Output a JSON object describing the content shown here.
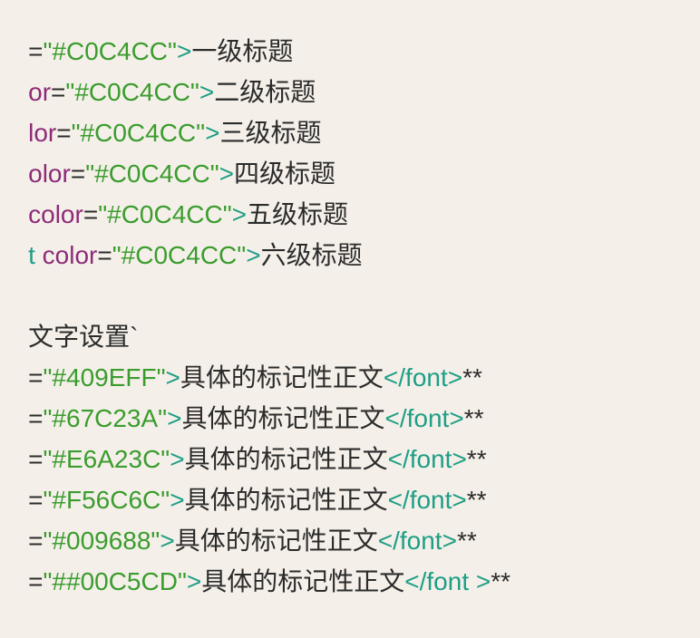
{
  "editor": {
    "heading_lines": [
      {
        "attr": "",
        "eq": "=",
        "value": "\"#C0C4CC\"",
        "close": ">",
        "text": "一级标题"
      },
      {
        "attr": "or",
        "eq": "=",
        "value": "\"#C0C4CC\"",
        "close": ">",
        "text": "二级标题"
      },
      {
        "attr": "lor",
        "eq": "=",
        "value": "\"#C0C4CC\"",
        "close": ">",
        "text": "三级标题"
      },
      {
        "attr": "olor",
        "eq": "=",
        "value": "\"#C0C4CC\"",
        "close": ">",
        "text": "四级标题"
      },
      {
        "attr": "color",
        "eq": "=",
        "value": "\"#C0C4CC\"",
        "close": ">",
        "text": "五级标题"
      },
      {
        "tag_prefix": "t",
        "attr": " color",
        "eq": "=",
        "value": "\"#C0C4CC\"",
        "close": ">",
        "text": "六级标题"
      }
    ],
    "section_label": "文字设置`",
    "body_lines": [
      {
        "eq": "=",
        "value": "\"#409EFF\"",
        "close": ">",
        "text": "具体的标记性正文",
        "end_tag": "</font>",
        "tail": "**"
      },
      {
        "eq": "=",
        "value": "\"#67C23A\"",
        "close": ">",
        "text": "具体的标记性正文",
        "end_tag": "</font>",
        "tail": "**"
      },
      {
        "eq": "=",
        "value": "\"#E6A23C\"",
        "close": ">",
        "text": "具体的标记性正文",
        "end_tag": "</font>",
        "tail": "**"
      },
      {
        "eq": "=",
        "value": "\"#F56C6C\"",
        "close": ">",
        "text": "具体的标记性正文",
        "end_tag": "</font>",
        "tail": "**"
      },
      {
        "eq": "=",
        "value": "\"#009688\"",
        "close": ">",
        "text": "具体的标记性正文",
        "end_tag": "</font>",
        "tail": "**"
      },
      {
        "eq": "=",
        "value": "\"##00C5CD\"",
        "close": ">",
        "text": "具体的标记性正文",
        "end_tag": "</font >",
        "tail": "**"
      }
    ]
  },
  "colors": {
    "background": "#F4F0E9",
    "attribute": "#8E2B79",
    "string": "#3B9C2E",
    "tag": "#1E9E86",
    "text": "#2B2B2B"
  }
}
